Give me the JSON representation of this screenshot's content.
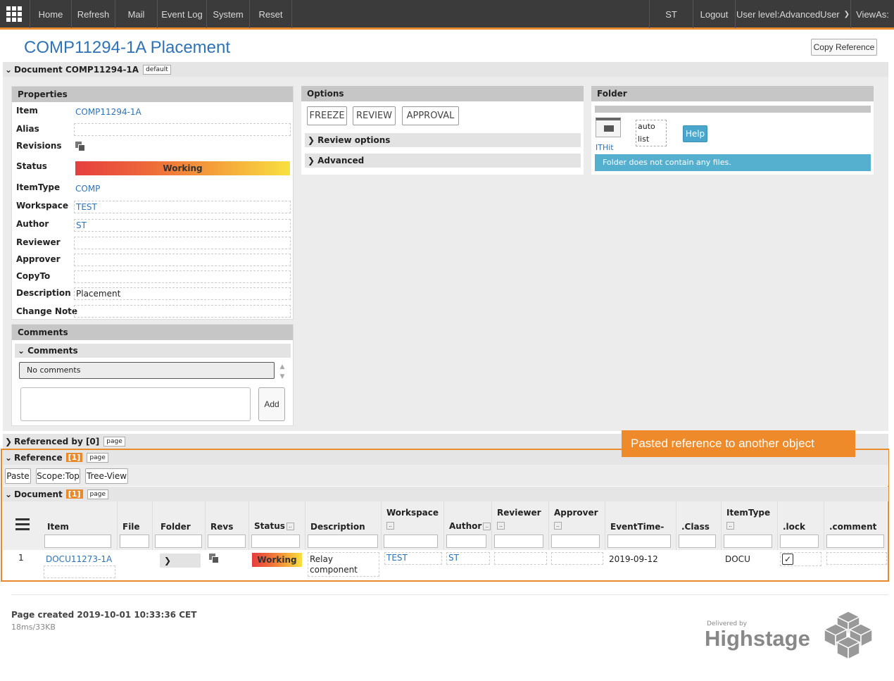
{
  "topbar": {
    "items": [
      "Home",
      "Refresh",
      "Mail",
      "Event Log",
      "System",
      "Reset"
    ],
    "user": "ST",
    "logout": "Logout",
    "user_level": "User level:AdvancedUser",
    "views_as": "ViewAs:"
  },
  "page_title": "COMP11294-1A Placement",
  "copy_reference": "Copy Reference",
  "document_section": {
    "label": "Document COMP11294-1A",
    "tag": "default"
  },
  "properties": {
    "title": "Properties",
    "rows": [
      {
        "label": "Item",
        "value": "COMP11294-1A"
      },
      {
        "label": "Alias",
        "value": ""
      },
      {
        "label": "Revisions",
        "value": ""
      },
      {
        "label": "Status",
        "value": "Working"
      },
      {
        "label": "ItemType",
        "value": "COMP"
      },
      {
        "label": "Workspace",
        "value": "TEST"
      },
      {
        "label": "Author",
        "value": "ST"
      },
      {
        "label": "Reviewer",
        "value": ""
      },
      {
        "label": "Approver",
        "value": ""
      },
      {
        "label": "CopyTo",
        "value": ""
      },
      {
        "label": "Description",
        "value": "Placement"
      },
      {
        "label": "Change Note",
        "value": ""
      }
    ]
  },
  "comments": {
    "title": "Comments",
    "sub_title": "Comments",
    "no_comments": "No comments",
    "add": "Add"
  },
  "options": {
    "title": "Options",
    "buttons": [
      "FREEZE",
      "REVIEW",
      "APPROVAL"
    ],
    "review_options": "Review options",
    "advanced": "Advanced"
  },
  "folder": {
    "title": "Folder",
    "ithit": "ITHit",
    "auto": "auto",
    "list": "list",
    "help": "Help",
    "empty_msg": "Folder does not contain any files."
  },
  "referenced_by": {
    "label": "Referenced by [0]",
    "tag": "page"
  },
  "reference": {
    "label": "Reference",
    "count": "[1]",
    "tag": "page",
    "buttons": [
      "Paste",
      "Scope:Top",
      "Tree-View"
    ]
  },
  "callout": "Pasted reference to another object",
  "document_sub": {
    "label": "Document",
    "count": "[1]",
    "tag": "page"
  },
  "table": {
    "headers": [
      "Item",
      "File",
      "Folder",
      "Revs",
      "Status",
      "Description",
      "Workspace",
      "Author",
      "Reviewer",
      "Approver",
      "EventTime-",
      ".Class",
      "ItemType",
      ".lock",
      ".comment"
    ],
    "row": {
      "num": "1",
      "item": "DOCU11273-1A",
      "status": "Working",
      "description": "Relay component",
      "workspace": "TEST",
      "author": "ST",
      "event_time": "2019-09-12",
      "item_type": "DOCU"
    }
  },
  "footer": {
    "created": "Page created 2019-10-01 10:33:36 CET",
    "stats": "18ms/33KB",
    "delivered_by": "Delivered by",
    "brand": "Highstage"
  },
  "colors": {
    "accent": "#e8892b",
    "link": "#2f73b6",
    "topbar": "#3b3b3b",
    "info": "#55b0d0"
  }
}
